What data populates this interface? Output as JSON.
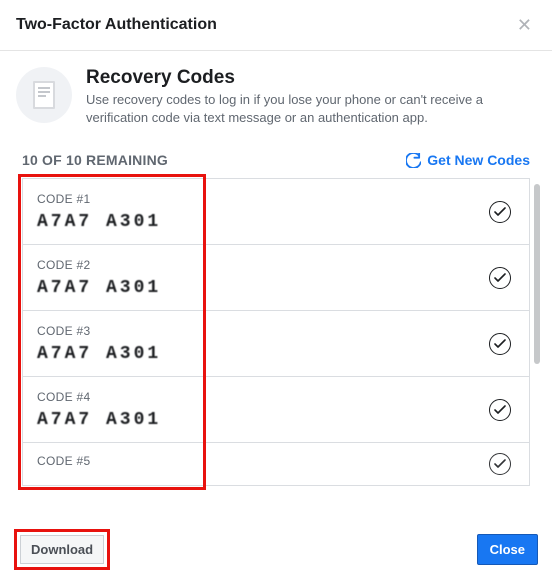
{
  "header": {
    "title": "Two-Factor Authentication"
  },
  "hero": {
    "title": "Recovery Codes",
    "description": "Use recovery codes to log in if you lose your phone or can't receive a verification code via text message or an authentication app."
  },
  "status": {
    "remaining": "10 OF 10 REMAINING",
    "get_new_label": "Get New Codes"
  },
  "codes": [
    {
      "label": "CODE #1",
      "value": "A7A7 A301"
    },
    {
      "label": "CODE #2",
      "value": "A7A7 A301"
    },
    {
      "label": "CODE #3",
      "value": "A7A7 A301"
    },
    {
      "label": "CODE #4",
      "value": "A7A7 A301"
    },
    {
      "label": "CODE #5",
      "value": ""
    }
  ],
  "footer": {
    "download_label": "Download",
    "close_label": "Close"
  },
  "colors": {
    "highlight": "#e8120e",
    "primary": "#1877f2"
  }
}
